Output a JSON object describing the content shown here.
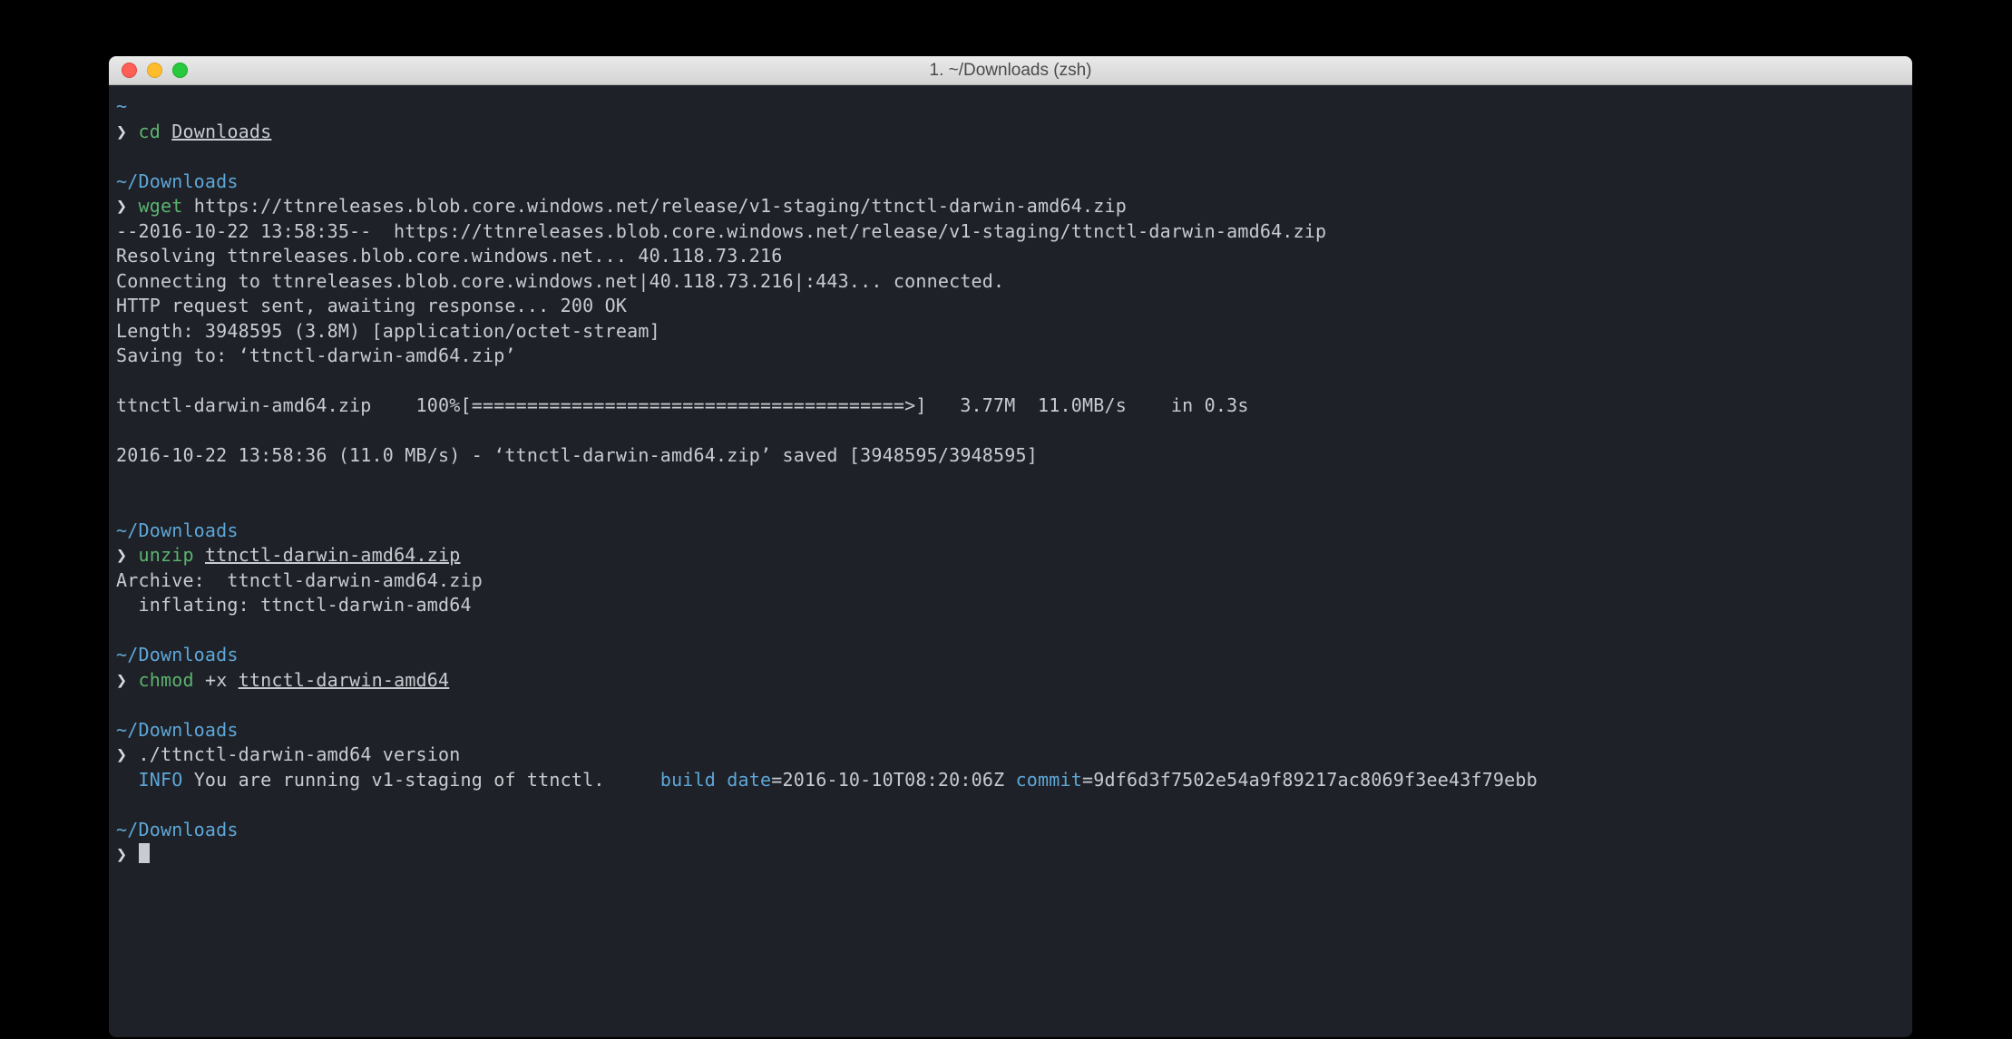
{
  "window": {
    "title": "1. ~/Downloads (zsh)"
  },
  "blocks": [
    {
      "cwd": "~",
      "prompt": "❯",
      "cmd": "cd",
      "arg": "Downloads",
      "argUnderline": true,
      "out": ""
    },
    {
      "cwd": "~/Downloads",
      "prompt": "❯",
      "cmd": "wget",
      "arg": "https://ttnreleases.blob.core.windows.net/release/v1-staging/ttnctl-darwin-amd64.zip",
      "out": "--2016-10-22 13:58:35--  https://ttnreleases.blob.core.windows.net/release/v1-staging/ttnctl-darwin-amd64.zip\nResolving ttnreleases.blob.core.windows.net... 40.118.73.216\nConnecting to ttnreleases.blob.core.windows.net|40.118.73.216|:443... connected.\nHTTP request sent, awaiting response... 200 OK\nLength: 3948595 (3.8M) [application/octet-stream]\nSaving to: ‘ttnctl-darwin-amd64.zip’\n\nttnctl-darwin-amd64.zip    100%[=======================================>]   3.77M  11.0MB/s    in 0.3s\n\n2016-10-22 13:58:36 (11.0 MB/s) - ‘ttnctl-darwin-amd64.zip’ saved [3948595/3948595]\n"
    },
    {
      "cwd": "~/Downloads",
      "prompt": "❯",
      "cmd": "unzip",
      "arg": "ttnctl-darwin-amd64.zip",
      "argUnderline": true,
      "out": "Archive:  ttnctl-darwin-amd64.zip\n  inflating: ttnctl-darwin-amd64"
    },
    {
      "cwd": "~/Downloads",
      "prompt": "❯",
      "cmd": "chmod",
      "argPlain": "+x ",
      "arg": "ttnctl-darwin-amd64",
      "argUnderline": true,
      "out": ""
    },
    {
      "cwd": "~/Downloads",
      "prompt": "❯",
      "cmdPlain": "./ttnctl-darwin-amd64 version",
      "infoLine": {
        "tag": "INFO",
        "msg": " You are running v1-staging of ttnctl.     ",
        "kv": [
          {
            "k": "build date",
            "v": "=2016-10-10T08:20:06Z "
          },
          {
            "k": "commit",
            "v": "=9df6d3f7502e54a9f89217ac8069f3ee43f79ebb"
          }
        ]
      }
    },
    {
      "cwd": "~/Downloads",
      "prompt": "❯",
      "cursor": true
    }
  ]
}
